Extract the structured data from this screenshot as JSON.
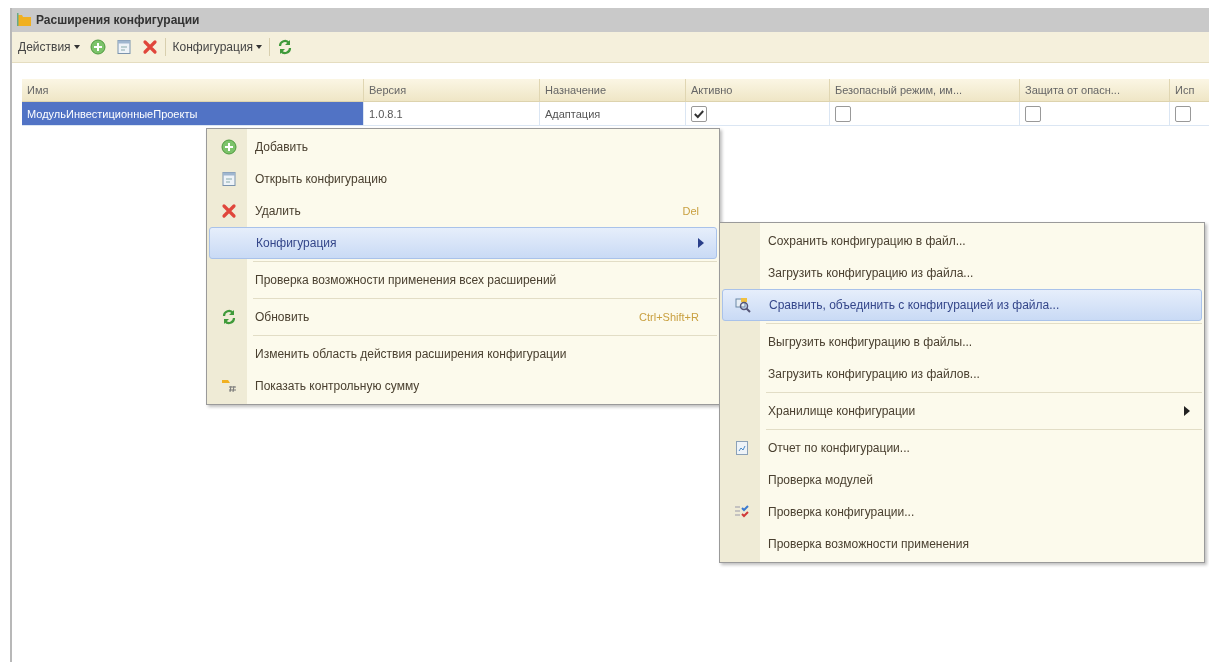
{
  "window": {
    "title": "Расширения конфигурации"
  },
  "toolbar": [
    {
      "kind": "menu",
      "label": "Действия"
    },
    {
      "kind": "icon"
    },
    {
      "kind": "icon"
    },
    {
      "kind": "icon"
    },
    {
      "kind": "separator"
    },
    {
      "kind": "menu",
      "label": "Конфигурация"
    },
    {
      "kind": "separator"
    },
    {
      "kind": "icon"
    }
  ],
  "table": {
    "columns": [
      "Имя",
      "Версия",
      "Назначение",
      "Активно",
      "Безопасный режим, им...",
      "Защита от опасн...",
      "Исп"
    ],
    "rows": [
      {
        "selected": true,
        "name": "МодульИнвестиционныеПроекты",
        "version": "1.0.8.1",
        "purpose": "Адаптация",
        "active": true,
        "safe_mode": false,
        "protection": false,
        "column_7": false
      }
    ]
  },
  "context_menu": {
    "items": [
      {
        "kind": "item",
        "label": "Добавить",
        "selected": false
      },
      {
        "kind": "item",
        "label": "Открыть конфигурацию",
        "selected": false
      },
      {
        "kind": "item",
        "label": "Удалить",
        "shortcut": "Del",
        "selected": false
      },
      {
        "kind": "item",
        "label": "Конфигурация",
        "submenu": true,
        "selected": true
      },
      {
        "kind": "separator"
      },
      {
        "kind": "item",
        "label": "Проверка возможности применения всех расширений",
        "selected": false
      },
      {
        "kind": "separator"
      },
      {
        "kind": "item",
        "label": "Обновить",
        "shortcut": "Ctrl+Shift+R",
        "selected": false
      },
      {
        "kind": "separator"
      },
      {
        "kind": "item",
        "label": "Изменить область действия расширения конфигурации",
        "selected": false
      },
      {
        "kind": "item",
        "label": "Показать контрольную сумму",
        "selected": false
      }
    ]
  },
  "submenu": {
    "items": [
      {
        "kind": "item",
        "label": "Сохранить конфигурацию в файл...",
        "selected": false
      },
      {
        "kind": "item",
        "label": "Загрузить конфигурацию из файла...",
        "selected": false
      },
      {
        "kind": "item",
        "label": "Сравнить, объединить с конфигурацией из файла...",
        "selected": true
      },
      {
        "kind": "separator"
      },
      {
        "kind": "item",
        "label": "Выгрузить конфигурацию в файлы...",
        "selected": false
      },
      {
        "kind": "item",
        "label": "Загрузить конфигурацию из файлов...",
        "selected": false
      },
      {
        "kind": "separator"
      },
      {
        "kind": "item",
        "label": "Хранилище конфигурации",
        "submenu": true,
        "selected": false
      },
      {
        "kind": "separator"
      },
      {
        "kind": "item",
        "label": "Отчет по конфигурации...",
        "selected": false
      },
      {
        "kind": "item",
        "label": "Проверка модулей",
        "selected": false
      },
      {
        "kind": "item",
        "label": "Проверка конфигурации...",
        "selected": false
      },
      {
        "kind": "item",
        "label": "Проверка возможности применения",
        "selected": false
      }
    ]
  }
}
